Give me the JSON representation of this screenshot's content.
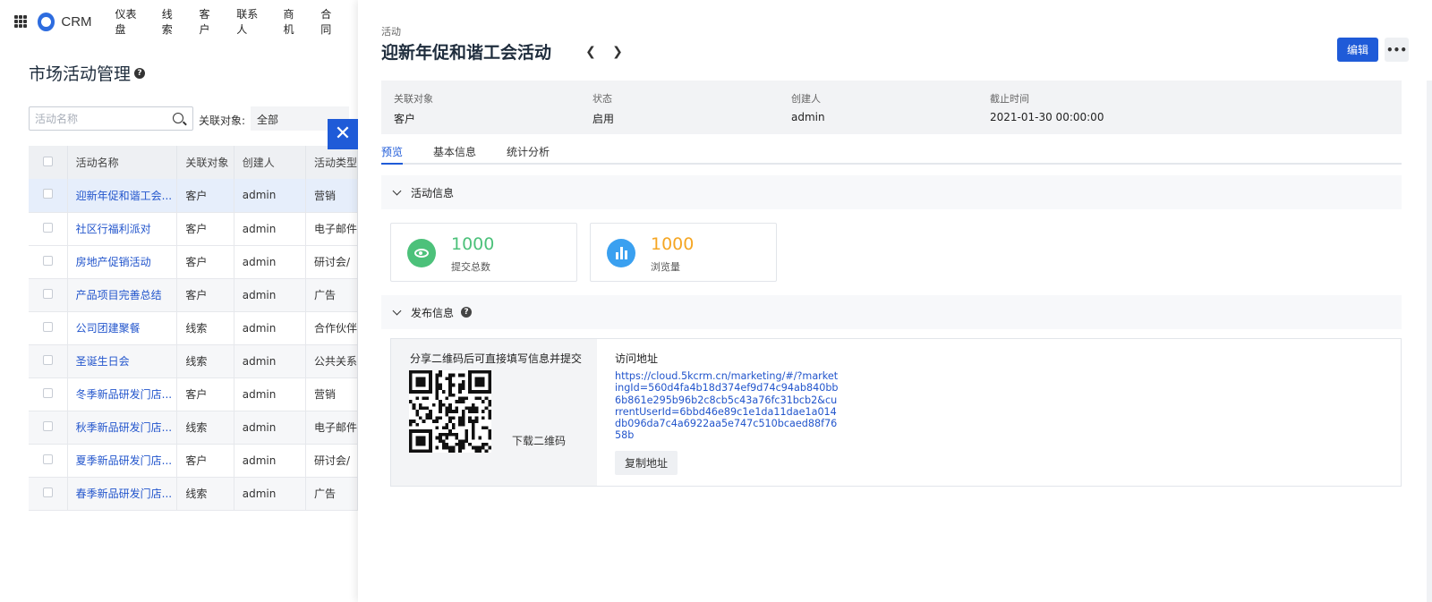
{
  "topnav": {
    "brand": "CRM",
    "items": [
      "仪表盘",
      "线索",
      "客户",
      "联系人",
      "商机",
      "合同"
    ]
  },
  "page": {
    "title": "市场活动管理",
    "help": "?",
    "search": {
      "placeholder": "活动名称"
    },
    "filter": {
      "label": "关联对象:",
      "value": "全部"
    }
  },
  "table": {
    "headers": [
      "活动名称",
      "关联对象",
      "创建人",
      "活动类型"
    ],
    "rows": [
      {
        "name": "迎新年促和谐工会...",
        "object": "客户",
        "creator": "admin",
        "type": "营销"
      },
      {
        "name": "社区行福利派对",
        "object": "客户",
        "creator": "admin",
        "type": "电子邮件"
      },
      {
        "name": "房地产促销活动",
        "object": "客户",
        "creator": "admin",
        "type": "研讨会/"
      },
      {
        "name": "产品项目完善总结",
        "object": "客户",
        "creator": "admin",
        "type": "广告"
      },
      {
        "name": "公司团建聚餐",
        "object": "线索",
        "creator": "admin",
        "type": "合作伙伴"
      },
      {
        "name": "圣诞生日会",
        "object": "线索",
        "creator": "admin",
        "type": "公共关系"
      },
      {
        "name": "冬季新品研发门店...",
        "object": "客户",
        "creator": "admin",
        "type": "营销"
      },
      {
        "name": "秋季新品研发门店...",
        "object": "线索",
        "creator": "admin",
        "type": "电子邮件"
      },
      {
        "name": "夏季新品研发门店...",
        "object": "客户",
        "creator": "admin",
        "type": "研讨会/"
      },
      {
        "name": "春季新品研发门店...",
        "object": "线索",
        "creator": "admin",
        "type": "广告"
      }
    ]
  },
  "drawer": {
    "crumb": "活动",
    "title": "迎新年促和谐工会活动",
    "edit_label": "编辑",
    "more_label": "•••",
    "summary": [
      {
        "label": "关联对象",
        "value": "客户"
      },
      {
        "label": "状态",
        "value": "启用"
      },
      {
        "label": "创建人",
        "value": "admin"
      },
      {
        "label": "截止时间",
        "value": "2021-01-30 00:00:00"
      }
    ],
    "tabs": [
      "预览",
      "基本信息",
      "统计分析"
    ],
    "activity_section": "活动信息",
    "stats": [
      {
        "value": "1000",
        "label": "提交总数",
        "color": "#4cc17a",
        "icon": "eye-icon"
      },
      {
        "value": "1000",
        "label": "浏览量",
        "color": "#f5a623",
        "icon": "bar-chart-icon"
      }
    ],
    "publish_section": "发布信息",
    "qr_title": "分享二维码后可直接填写信息并提交",
    "qr_download": "下载二维码",
    "url_title": "访问地址",
    "url": "https://cloud.5kcrm.cn/marketing/#/?marketingId=560d4fa4b18d374ef9d74c94ab840bb6b861e295b96b2c8cb5c43a76fc31bcb2&currentUserId=6bbd46e89c1e1da11dae1a014db096da7c4a6922aa5e747c510bcaed88f7658b",
    "copy_label": "复制地址"
  },
  "colors": {
    "accent": "#1f5bd8",
    "link": "#2255cc",
    "green": "#4cc17a",
    "blue_icon": "#3aa0f0",
    "orange": "#f5a623"
  }
}
